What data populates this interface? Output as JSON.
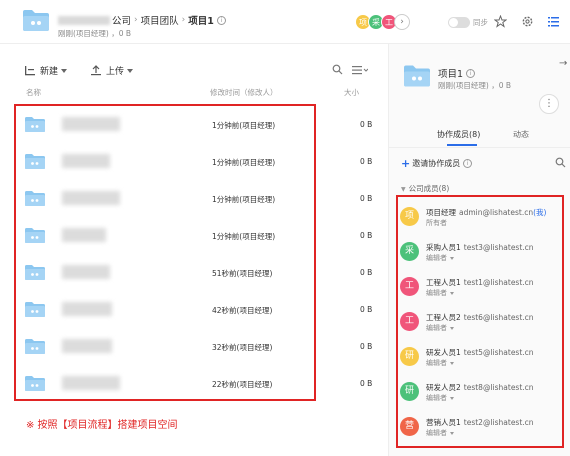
{
  "header": {
    "breadcrumb": [
      "公司",
      "项目团队",
      "项目1"
    ],
    "subtitle": "刚刚(项目经理) ，0 B",
    "avatars": [
      {
        "char": "项",
        "color": "#f7c948"
      },
      {
        "char": "采",
        "color": "#4cc17a"
      },
      {
        "char": "工",
        "color": "#f0557a"
      }
    ],
    "more_glyph": "›",
    "sync_label": "同步",
    "info_glyph": "i"
  },
  "toolbar": {
    "new_label": "新建",
    "upload_label": "上传"
  },
  "columns": {
    "name": "名称",
    "modified": "修改时间（修改人）",
    "size": "大小"
  },
  "files": [
    {
      "modified": "1分钟前(项目经理)",
      "size": "0 B",
      "blur_w": 58
    },
    {
      "modified": "1分钟前(项目经理)",
      "size": "0 B",
      "blur_w": 48
    },
    {
      "modified": "1分钟前(项目经理)",
      "size": "0 B",
      "blur_w": 58
    },
    {
      "modified": "1分钟前(项目经理)",
      "size": "0 B",
      "blur_w": 44
    },
    {
      "modified": "51秒前(项目经理)",
      "size": "0 B",
      "blur_w": 48
    },
    {
      "modified": "42秒前(项目经理)",
      "size": "0 B",
      "blur_w": 50
    },
    {
      "modified": "32秒前(项目经理)",
      "size": "0 B",
      "blur_w": 50
    },
    {
      "modified": "22秒前(项目经理)",
      "size": "0 B",
      "blur_w": 58
    }
  ],
  "note": "※ 按照【项目流程】搭建项目空间",
  "panel": {
    "title": "项目1",
    "subtitle": "刚刚(项目经理) ，0 B",
    "more_glyph": "⋮",
    "arrow_glyph": "→",
    "tab_members": "协作成员(8)",
    "tab_activity": "动态",
    "invite_plus": "+",
    "invite_label": "邀请协作成员",
    "company_chev": "▼",
    "company_label": "公司成员(8)",
    "members": [
      {
        "avatar": "项",
        "color": "#f7c948",
        "name": "项目经理",
        "email": "admin@lishatest.cn",
        "tag": "(我)",
        "role": "所有者",
        "dropdown": false
      },
      {
        "avatar": "采",
        "color": "#4cc17a",
        "name": "采购人员1",
        "email": "test3@lishatest.cn",
        "tag": "",
        "role": "编辑者",
        "dropdown": true
      },
      {
        "avatar": "工",
        "color": "#f0557a",
        "name": "工程人员1",
        "email": "test1@lishatest.cn",
        "tag": "",
        "role": "编辑者",
        "dropdown": true
      },
      {
        "avatar": "工",
        "color": "#f0557a",
        "name": "工程人员2",
        "email": "test6@lishatest.cn",
        "tag": "",
        "role": "编辑者",
        "dropdown": true
      },
      {
        "avatar": "研",
        "color": "#f7c948",
        "name": "研发人员1",
        "email": "test5@lishatest.cn",
        "tag": "",
        "role": "编辑者",
        "dropdown": true
      },
      {
        "avatar": "研",
        "color": "#4cc17a",
        "name": "研发人员2",
        "email": "test8@lishatest.cn",
        "tag": "",
        "role": "编辑者",
        "dropdown": true
      },
      {
        "avatar": "营",
        "color": "#f06548",
        "name": "营销人员1",
        "email": "test2@lishatest.cn",
        "tag": "",
        "role": "编辑者",
        "dropdown": true
      }
    ]
  },
  "colors": {
    "accent": "#2b6de8",
    "highlight_box": "#e02424",
    "folder": "#8cc7f0"
  }
}
